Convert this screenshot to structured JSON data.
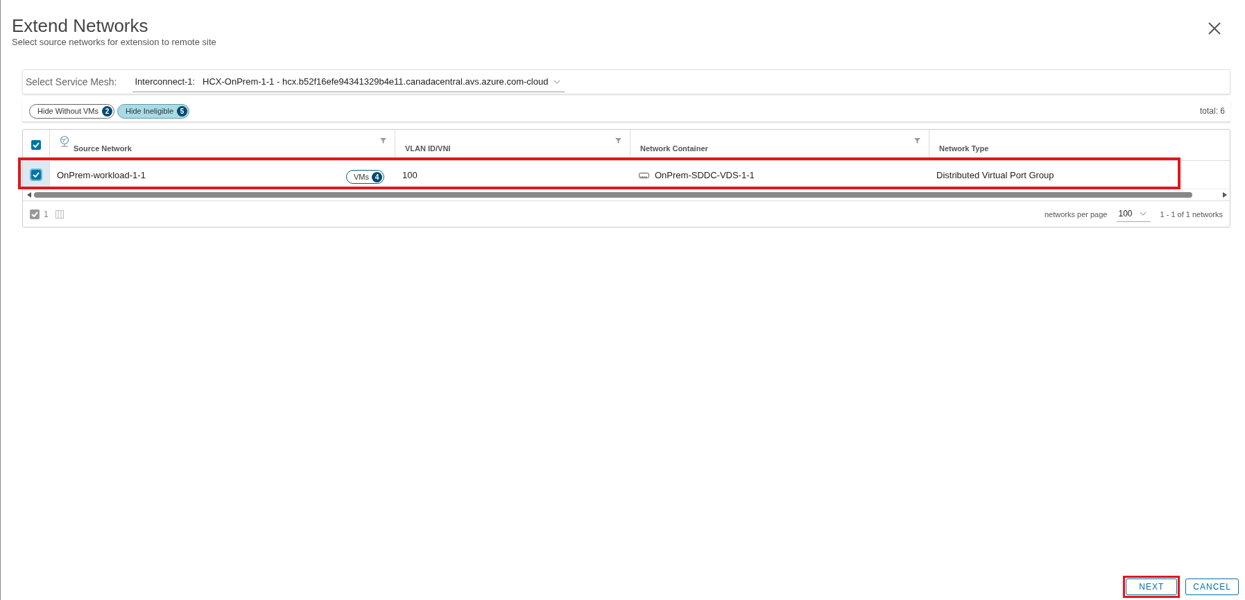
{
  "dialog": {
    "title": "Extend Networks",
    "subtitle": "Select source networks for extension to remote site"
  },
  "service_mesh": {
    "label": "Select Service Mesh:",
    "value": "Interconnect-1:   HCX-OnPrem-1-1 - hcx.b52f16efe94341329b4e11.canadacentral.avs.azure.com-cloud"
  },
  "filters": [
    {
      "label": "Hide Without VMs",
      "count": "2",
      "selected": false
    },
    {
      "label": "Hide Ineligible",
      "count": "5",
      "selected": true
    }
  ],
  "total": "total: 6",
  "table": {
    "select_all": {
      "checked": true
    },
    "columns": [
      {
        "label": "Source Network",
        "filter": true,
        "icon": true
      },
      {
        "label": "VLAN ID/VNI",
        "filter": true,
        "icon": false
      },
      {
        "label": "Network Container",
        "filter": true,
        "icon": false
      },
      {
        "label": "Network Type",
        "filter": false,
        "icon": false
      }
    ],
    "rows": [
      {
        "checked": true,
        "highlighted": true,
        "source_network": "OnPrem-workload-1-1",
        "vms_label": "VMs",
        "vms_count": "4",
        "vlan": "100",
        "container": "OnPrem-SDDC-VDS-1-1",
        "type": "Distributed Virtual Port Group"
      }
    ],
    "footer": {
      "selected_count": "1",
      "per_page_label": "networks per page",
      "per_page": "100",
      "range": "1 - 1 of 1 networks"
    }
  },
  "buttons": [
    {
      "label": "NEXT",
      "highlighted": true
    },
    {
      "label": "CANCEL",
      "highlighted": false
    }
  ]
}
